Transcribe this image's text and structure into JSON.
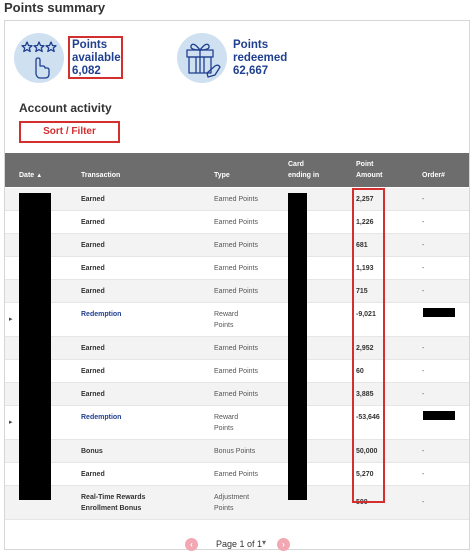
{
  "page_title": "Points summary",
  "summary": {
    "available": {
      "label_line1": "Points",
      "label_line2": "available",
      "value": "6,082"
    },
    "redeemed": {
      "label_line1": "Points",
      "label_line2": "redeemed",
      "value": "62,667"
    }
  },
  "activity": {
    "title": "Account activity",
    "sort_filter_label": "Sort / Filter"
  },
  "table": {
    "headers": {
      "date": "Date",
      "transaction": "Transaction",
      "type": "Type",
      "card_line1": "Card",
      "card_line2": "ending in",
      "amount_line1": "Point",
      "amount_line2": "Amount",
      "order": "Order#"
    },
    "rows": [
      {
        "transaction": "Earned",
        "type": "Earned Points",
        "amount": "2,257",
        "order": "-"
      },
      {
        "transaction": "Earned",
        "type": "Earned Points",
        "amount": "1,226",
        "order": "-"
      },
      {
        "transaction": "Earned",
        "type": "Earned Points",
        "amount": "681",
        "order": "-"
      },
      {
        "transaction": "Earned",
        "type": "Earned Points",
        "amount": "1,193",
        "order": "-"
      },
      {
        "transaction": "Earned",
        "type": "Earned Points",
        "amount": "715",
        "order": "-"
      },
      {
        "transaction": "Redemption",
        "type_line1": "Reward",
        "type_line2": "Points",
        "amount": "-9,021"
      },
      {
        "transaction": "Earned",
        "type": "Earned Points",
        "amount": "2,952",
        "order": "-"
      },
      {
        "transaction": "Earned",
        "type": "Earned Points",
        "amount": "60",
        "order": "-"
      },
      {
        "transaction": "Earned",
        "type": "Earned Points",
        "amount": "3,885",
        "order": "-"
      },
      {
        "transaction": "Redemption",
        "type_line1": "Reward",
        "type_line2": "Points",
        "amount": "-53,646"
      },
      {
        "transaction": "Bonus",
        "type": "Bonus Points",
        "amount": "50,000",
        "order": "-"
      },
      {
        "transaction": "Earned",
        "type": "Earned Points",
        "amount": "5,270",
        "order": "-"
      },
      {
        "transaction_line1": "Real-Time Rewards",
        "transaction_line2": "Enrollment Bonus",
        "type_line1": "Adjustment",
        "type_line2": "Points",
        "amount": "500",
        "order": "-"
      }
    ]
  },
  "pager": {
    "label": "Page 1 of 1",
    "prev_icon": "chevron-left-icon",
    "next_icon": "chevron-right-icon"
  },
  "colors": {
    "accent_red": "#d32f2f",
    "brand_blue": "#1f3f8f",
    "header_gray": "#6d6d6d",
    "icon_circle": "#cfe0f1"
  }
}
